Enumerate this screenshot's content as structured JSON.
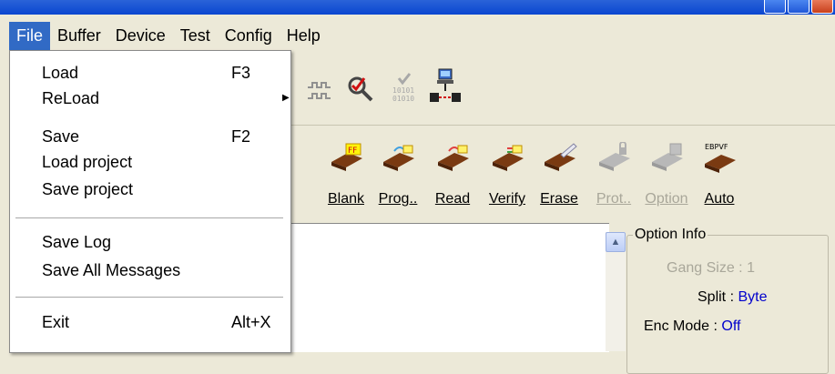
{
  "menubar": {
    "items": [
      {
        "label": "File",
        "active": true
      },
      {
        "label": "Buffer"
      },
      {
        "label": "Device"
      },
      {
        "label": "Test"
      },
      {
        "label": "Config"
      },
      {
        "label": "Help"
      }
    ]
  },
  "file_menu": {
    "items": [
      {
        "label": "Load",
        "shortcut": "F3"
      },
      {
        "label": "ReLoad",
        "submenu": true
      },
      {
        "label": "Save",
        "shortcut": "F2"
      },
      {
        "label": "Load project"
      },
      {
        "label": "Save project"
      },
      {
        "label": "Save Log"
      },
      {
        "label": "Save All Messages"
      },
      {
        "label": "Exit",
        "shortcut": "Alt+X"
      }
    ]
  },
  "toolbar_icons": [
    "waveform-icon",
    "device-search-icon",
    "binary-check-icon",
    "programmer-connect-icon"
  ],
  "toolbar": {
    "buttons": [
      {
        "label": "Blank",
        "enabled": true,
        "badge": "FF"
      },
      {
        "label": "Prog..",
        "enabled": true
      },
      {
        "label": "Read",
        "enabled": true
      },
      {
        "label": "Verify",
        "enabled": true
      },
      {
        "label": "Erase",
        "enabled": true
      },
      {
        "label": "Prot..",
        "enabled": false
      },
      {
        "label": "Option",
        "enabled": false
      },
      {
        "label": "Auto",
        "enabled": true,
        "badge": "EBPVF"
      }
    ]
  },
  "option_info": {
    "title": "Option Info",
    "gang_size_key": "Gang Size :",
    "gang_size_val": "1",
    "split_key": "Split :",
    "split_val": "Byte",
    "enc_mode_key": "Enc Mode :",
    "enc_mode_val": "Off"
  },
  "colors": {
    "menu_highlight": "#316ac5",
    "value_blue": "#0000cc",
    "disabled": "#a9a79a"
  }
}
